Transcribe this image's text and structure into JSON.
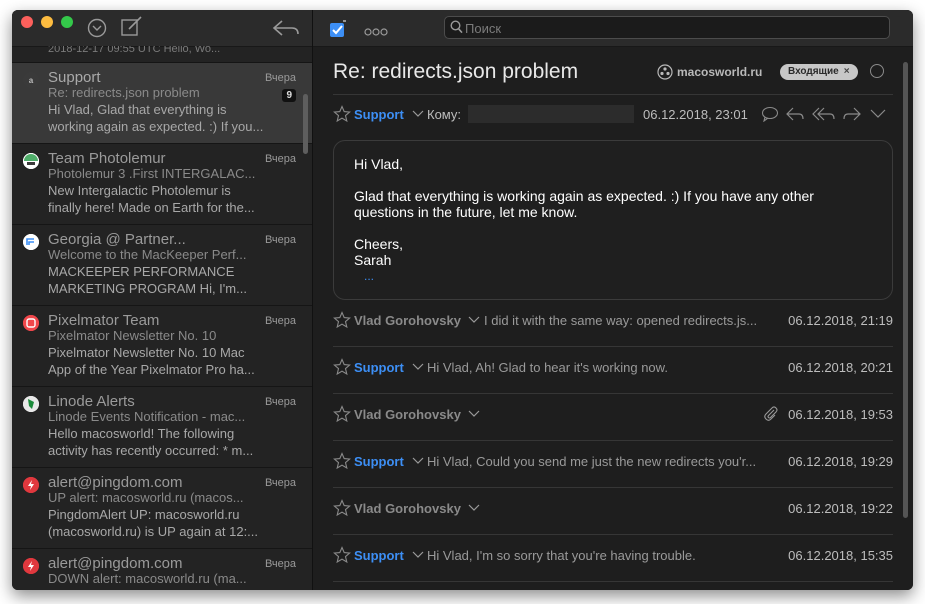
{
  "left_pane": {
    "cut_row_text": "2018-12-17 09:55 UTC Hello, Wo...",
    "messages": [
      {
        "from": "Support",
        "date": "Вчера",
        "subject": "Re: redirects.json problem",
        "preview": "Hi Vlad, Glad that everything is working again as expected. :) If you...",
        "count": "9",
        "avatar_letter": "a",
        "avatar_color": "#3a3a3a"
      },
      {
        "from": "Team Photolemur",
        "date": "Вчера",
        "subject": "Photolemur 3 .First INTERGALAC...",
        "preview": "New Intergalactic Photolemur is finally here! Made on Earth for the...",
        "avatar_letter": "",
        "avatar_color": "#4fae6a"
      },
      {
        "from": "Georgia @ Partner...",
        "date": "Вчера",
        "subject": "Welcome to the MacKeeper Perf...",
        "preview": "MACKEEPER PERFORMANCE MARKETING PROGRAM Hi, I'm...",
        "avatar_letter": "",
        "avatar_color": "#e6e6e6"
      },
      {
        "from": "Pixelmator Team",
        "date": "Вчера",
        "subject": "Pixelmator Newsletter No. 10",
        "preview": "Pixelmator Newsletter No. 10 Mac App of the Year Pixelmator Pro ha...",
        "avatar_letter": "",
        "avatar_color": "#f0474b"
      },
      {
        "from": "Linode Alerts",
        "date": "Вчера",
        "subject": "Linode Events Notification - mac...",
        "preview": "Hello macosworld! The following activity has recently occurred: * m...",
        "avatar_letter": "",
        "avatar_color": "#e8e8e8"
      },
      {
        "from": "alert@pingdom.com",
        "date": "Вчера",
        "subject": "UP alert: macosworld.ru (macos...",
        "preview": "PingdomAlert UP: macosworld.ru (macosworld.ru) is UP again at 12:...",
        "avatar_letter": "",
        "avatar_color": "#e0383e"
      },
      {
        "from": "alert@pingdom.com",
        "date": "Вчера",
        "subject": "DOWN alert: macosworld.ru (ma...",
        "preview": "",
        "avatar_letter": "",
        "avatar_color": "#e0383e"
      }
    ]
  },
  "toolbar": {
    "search_placeholder": "Поиск"
  },
  "message": {
    "title": "Re: redirects.json problem",
    "site": "macosworld.ru",
    "mailbox_tag": "Входящие",
    "tag_close": "×",
    "header": {
      "sender": "Support",
      "to_label": "Кому:",
      "date": "06.12.2018, 23:01"
    },
    "body": {
      "greeting": "Hi Vlad,",
      "paragraph": "Glad that everything is working again as expected. :) If you have any other questions in the future, let me know.",
      "closing": "Cheers,",
      "signature": "Sarah",
      "more": "..."
    },
    "thread": [
      {
        "sender": "Vlad Gorohovsky",
        "style": "grey",
        "snippet": "I did it with the same way: opened redirects.js...",
        "date": "06.12.2018, 21:19",
        "attachment": false
      },
      {
        "sender": "Support",
        "style": "blue",
        "snippet": "Hi Vlad, Ah! Glad to hear it's working now.",
        "date": "06.12.2018, 20:21",
        "attachment": false
      },
      {
        "sender": "Vlad Gorohovsky",
        "style": "grey",
        "snippet": "",
        "date": "06.12.2018, 19:53",
        "attachment": true
      },
      {
        "sender": "Support",
        "style": "blue",
        "snippet": "Hi Vlad, Could you send me just the new redirects you'r...",
        "date": "06.12.2018, 19:29",
        "attachment": false
      },
      {
        "sender": "Vlad Gorohovsky",
        "style": "grey",
        "snippet": "",
        "date": "06.12.2018, 19:22",
        "attachment": false
      },
      {
        "sender": "Support",
        "style": "blue",
        "snippet": "Hi Vlad, I'm so sorry that you're having trouble.",
        "date": "06.12.2018, 15:35",
        "attachment": false
      }
    ]
  },
  "colors": {
    "accent": "#3d8ff5",
    "window_bg": "#1e1e1e",
    "selected_row": "#393939"
  }
}
